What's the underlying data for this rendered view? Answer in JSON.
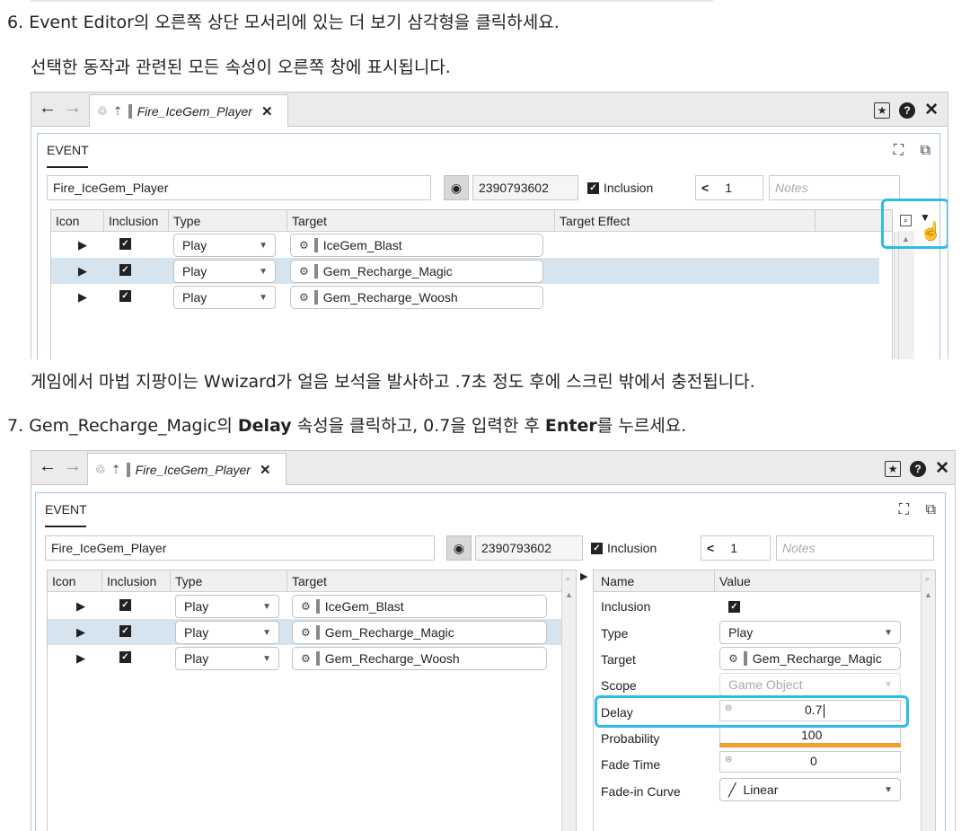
{
  "step6": {
    "number": "6.",
    "text": "Event Editor의 오른쪽 상단 모서리에 있는 더 보기 삼각형을 클릭하세요.",
    "note": "선택한 동작과 관련된 모든 속성이 오른쪽 창에 표시됩니다."
  },
  "between": "게임에서 마법 지팡이는 Wwizard가 얼음 보석을 발사하고 .7초 정도 후에 스크린 밖에서 충전됩니다.",
  "step7": {
    "number": "7.",
    "pre": "Gem_Recharge_Magic의 ",
    "bold1": "Delay",
    "mid": " 속성을 클릭하고, 0.7을 입력한 후 ",
    "bold2": "Enter",
    "post": "를 누르세요."
  },
  "editor": {
    "nav_back": "←",
    "nav_forward": "→",
    "tab_title": "Fire_IceGem_Player",
    "tab_close": "✕",
    "star": "★",
    "help": "?",
    "close": "✕",
    "section_label": "EVENT",
    "expand_icon": "⛶",
    "popout_icon": "⧉",
    "event_name": "Fire_IceGem_Player",
    "palette_icon": "◉",
    "event_id": "2390793602",
    "inclusion_label": "Inclusion",
    "check": "✓",
    "share_icon": "<",
    "ref_count": "1",
    "notes_placeholder": "Notes",
    "columns": [
      "Icon",
      "Inclusion",
      "Type",
      "Target",
      "Target Effect"
    ],
    "columns2": [
      "Icon",
      "Inclusion",
      "Type",
      "Target"
    ],
    "play_icon": "▶",
    "dropdown_arrow": "▼",
    "target_icon": "⚙",
    "rows": [
      {
        "type": "Play",
        "target": "IceGem_Blast"
      },
      {
        "type": "Play",
        "target": "Gem_Recharge_Magic"
      },
      {
        "type": "Play",
        "target": "Gem_Recharge_Woosh"
      }
    ],
    "search_icon": "🔍",
    "more_triangle": "▼",
    "more_triangle_right": "▶",
    "scroll_up": "▲"
  },
  "props": {
    "header_name": "Name",
    "header_value": "Value",
    "inclusion": "Inclusion",
    "type_label": "Type",
    "type_value": "Play",
    "target_label": "Target",
    "target_value": "Gem_Recharge_Magic",
    "scope_label": "Scope",
    "scope_value": "Game Object",
    "delay_label": "Delay",
    "delay_value": "0.7",
    "probability_label": "Probability",
    "probability_value": "100",
    "fade_label": "Fade Time",
    "fade_value": "0",
    "curve_label": "Fade-in Curve",
    "curve_icon": "╱",
    "curve_value": "Linear"
  },
  "colors": {
    "highlight": "#2bbde8",
    "selected_row": "#d6e4f0",
    "probability_bar": "#f39c31"
  }
}
